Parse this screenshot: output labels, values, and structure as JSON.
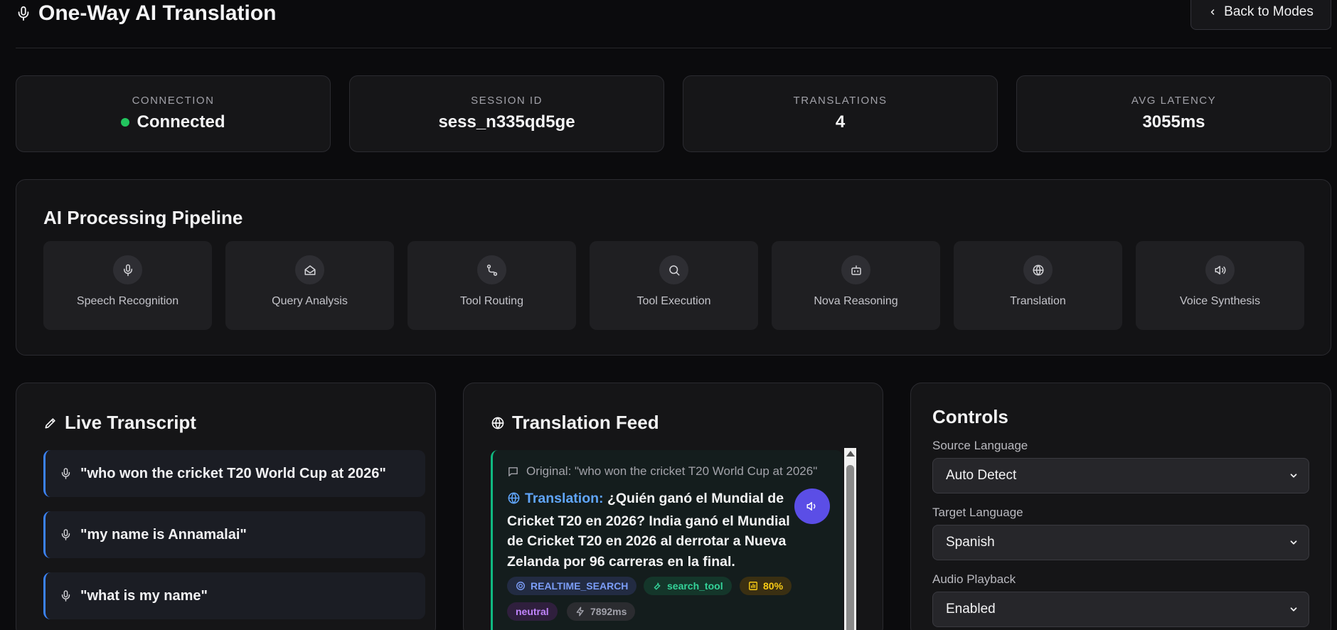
{
  "header": {
    "title": "One-Way AI Translation",
    "back_label": "Back to Modes"
  },
  "stats": [
    {
      "label": "CONNECTION",
      "value": "Connected",
      "status_color": "#22c55e"
    },
    {
      "label": "SESSION ID",
      "value": "sess_n335qd5ge"
    },
    {
      "label": "TRANSLATIONS",
      "value": "4"
    },
    {
      "label": "AVG LATENCY",
      "value": "3055ms"
    }
  ],
  "pipeline": {
    "title": "AI Processing Pipeline",
    "stages": [
      {
        "label": "Speech Recognition",
        "icon": "mic-icon"
      },
      {
        "label": "Query Analysis",
        "icon": "inbox-icon"
      },
      {
        "label": "Tool Routing",
        "icon": "route-icon"
      },
      {
        "label": "Tool Execution",
        "icon": "search-icon"
      },
      {
        "label": "Nova Reasoning",
        "icon": "bot-icon"
      },
      {
        "label": "Translation",
        "icon": "globe-icon"
      },
      {
        "label": "Voice Synthesis",
        "icon": "speaker-icon"
      }
    ]
  },
  "transcript": {
    "title": "Live Transcript",
    "items": [
      "\"who won the cricket T20 World Cup at 2026\"",
      "\"my name is Annamalai\"",
      "\"what is my name\""
    ]
  },
  "feed": {
    "title": "Translation Feed",
    "entry": {
      "original": "Original: \"who won the cricket T20 World Cup at 2026\"",
      "translation_label": "Translation:",
      "translation_text": " ¿Quién ganó el Mundial de Cricket T20 en 2026? India ganó el Mundial de Cricket T20 en 2026 al derrotar a Nueva Zelanda por 96 carreras en la final.",
      "intent": "REALTIME_SEARCH",
      "tool": "search_tool",
      "confidence": "80%",
      "sentiment": "neutral",
      "latency": "7892ms"
    }
  },
  "controls": {
    "title": "Controls",
    "source_label": "Source Language",
    "source_value": "Auto Detect",
    "target_label": "Target Language",
    "target_value": "Spanish",
    "audio_label": "Audio Playback",
    "audio_value": "Enabled"
  },
  "colors": {
    "accent": "#5b4ee6",
    "transcript_border": "#3b82f6",
    "feed_border": "#10b981"
  }
}
